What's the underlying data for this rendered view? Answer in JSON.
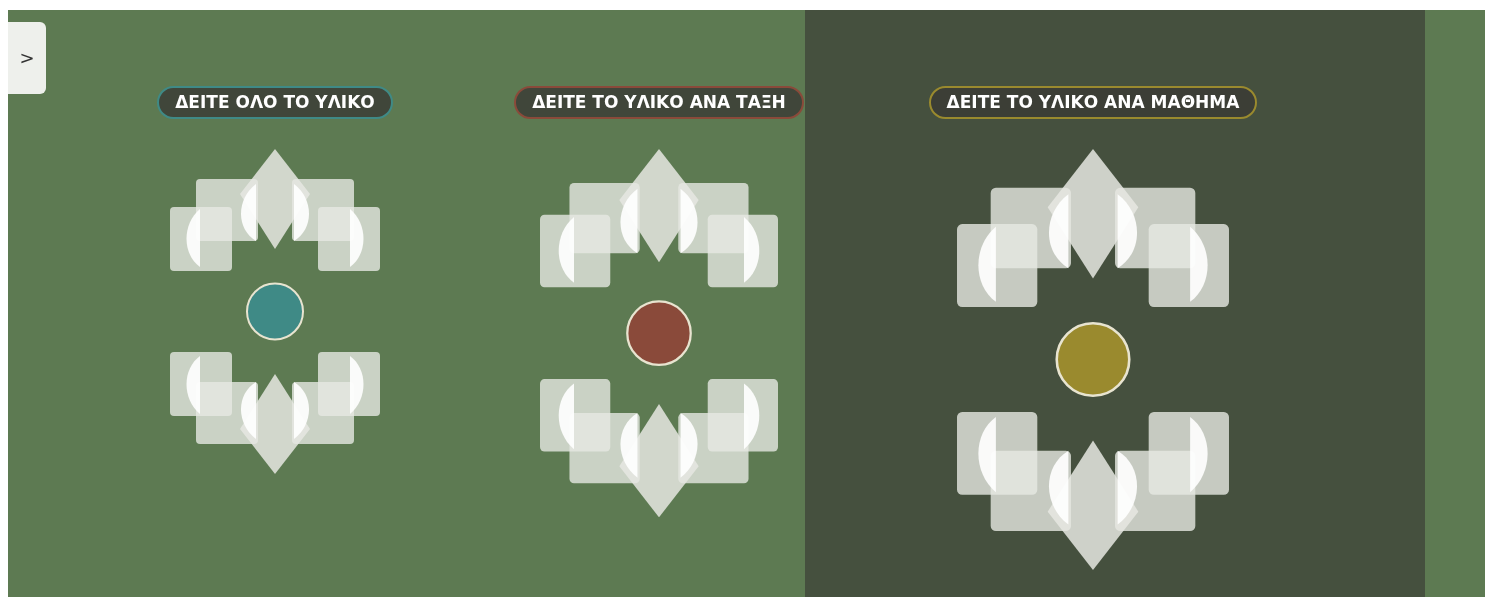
{
  "sidebar_toggle": {
    "label": ">"
  },
  "options": [
    {
      "label": "ΔΕΙΤΕ ΟΛΟ ΤΟ ΥΛΙΚΟ",
      "color": "#3f8a86"
    },
    {
      "label": "ΔΕΙΤΕ ΤΟ ΥΛΙΚΟ ΑΝΑ ΤΑΞΗ",
      "color": "#8a4a3a"
    },
    {
      "label": "ΔΕΙΤΕ ΤΟ ΥΛΙΚΟ ΑΝΑ ΜΑΘΗΜΑ",
      "color": "#9a8a2e"
    }
  ]
}
